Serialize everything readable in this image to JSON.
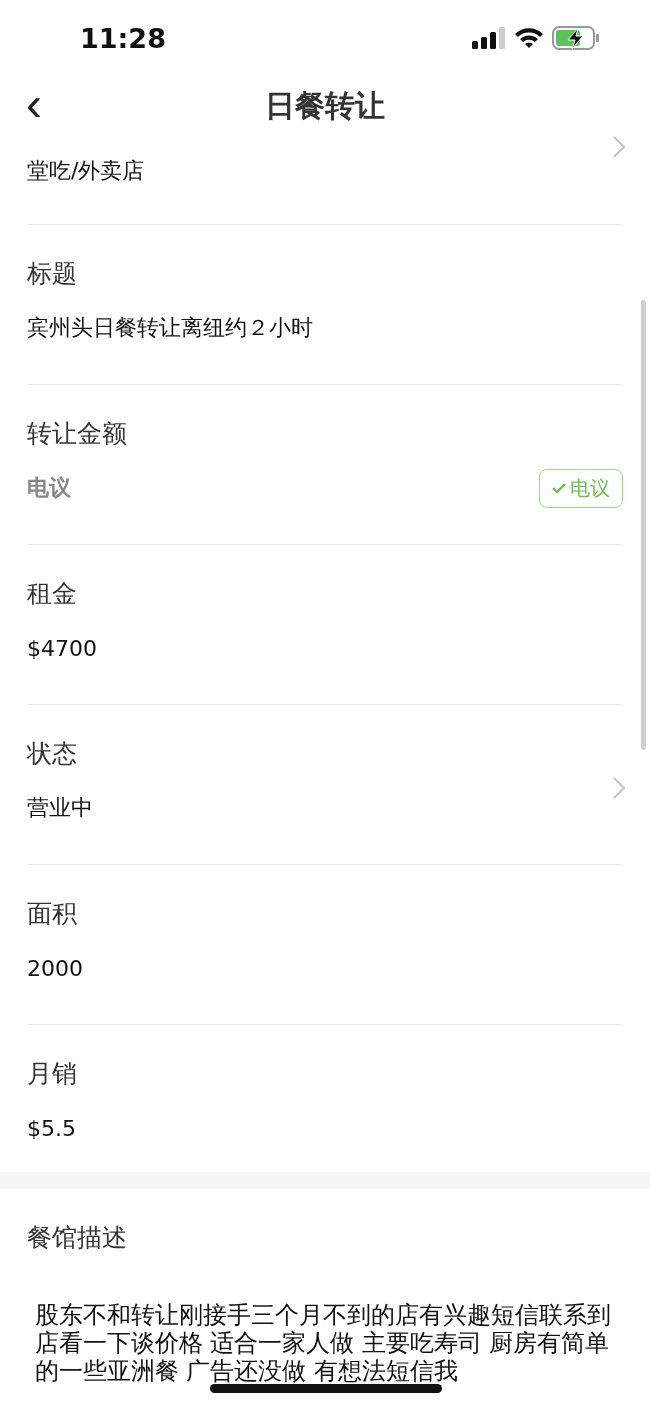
{
  "status_bar": {
    "time": "11:28"
  },
  "nav": {
    "back": "‹",
    "title": "日餐转让"
  },
  "fields": [
    {
      "value": "堂吃/外卖店",
      "chevron": true,
      "muted": false
    },
    {
      "label": "标题",
      "value": "宾州头日餐转让离纽约２小时",
      "chevron": false,
      "muted": false
    },
    {
      "label": "转让金额",
      "value": "电议",
      "chevron": false,
      "muted": true,
      "toggle": {
        "label": "电议",
        "selected": true
      }
    },
    {
      "label": "租金",
      "value": "$4700",
      "chevron": false,
      "muted": false
    },
    {
      "label": "状态",
      "value": "营业中",
      "chevron": true,
      "muted": false
    },
    {
      "label": "面积",
      "value": "2000",
      "chevron": false,
      "muted": false
    },
    {
      "label": "月销",
      "value": "$5.5",
      "chevron": false,
      "muted": false
    }
  ],
  "description": {
    "label": "餐馆描述",
    "text": "股东不和转让刚接手三个月不到的店有兴趣短信联系到店看一下谈价格 适合一家人做 主要吃寿司 厨房有简单的一些亚洲餐  广告还没做  有想法短信我"
  }
}
